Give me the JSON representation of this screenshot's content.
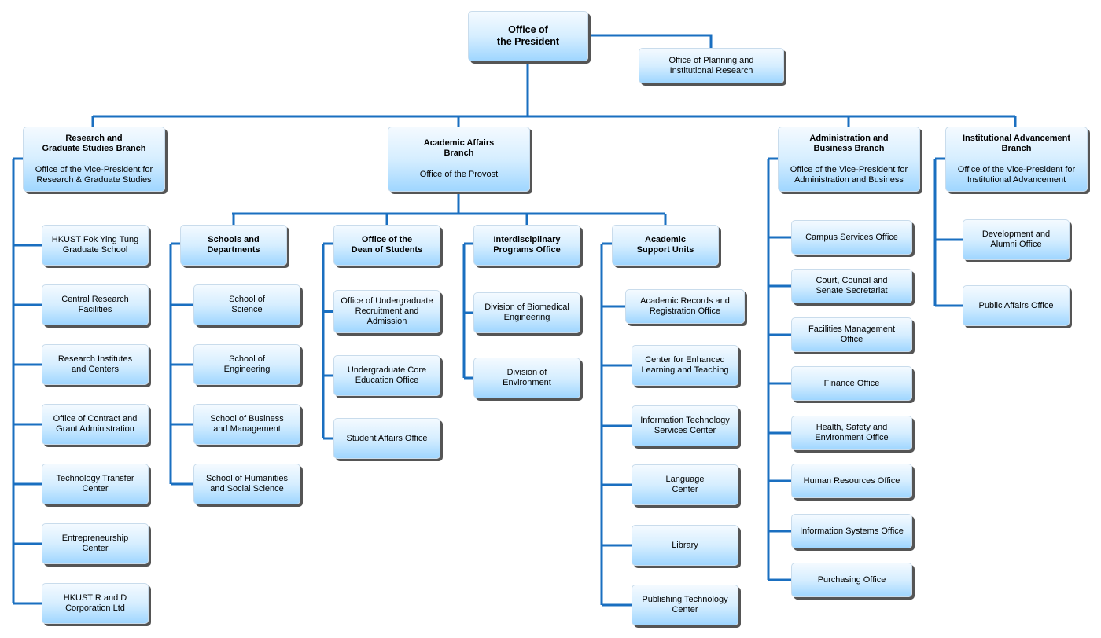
{
  "president": {
    "title": "Office of\nthe President"
  },
  "planning": {
    "title": "Office of Planning and\nInstitutional Research"
  },
  "branches": {
    "research": {
      "title": "Research and\nGraduate Studies Branch",
      "subtitle": "Office of the Vice-President for\nResearch & Graduate Studies",
      "children": [
        "HKUST Fok Ying Tung\nGraduate School",
        "Central Research\nFacilities",
        "Research Institutes\nand Centers",
        "Office of Contract and\nGrant Administration",
        "Technology Transfer\nCenter",
        "Entrepreneurship\nCenter",
        "HKUST R and D\nCorporation Ltd"
      ]
    },
    "academic": {
      "title": "Academic Affairs\nBranch",
      "subtitle": "Office of the Provost",
      "groups": {
        "schools": {
          "title": "Schools and\nDepartments",
          "children": [
            "School of\nScience",
            "School of\nEngineering",
            "School of Business\nand Management",
            "School of Humanities\nand Social Science"
          ]
        },
        "dean": {
          "title": "Office of the\nDean of Students",
          "children": [
            "Office of Undergraduate\nRecruitment and\nAdmission",
            "Undergraduate Core\nEducation Office",
            "Student Affairs Office"
          ]
        },
        "interdisciplinary": {
          "title": "Interdisciplinary\nPrograms Office",
          "children": [
            "Division of Biomedical\nEngineering",
            "Division of\nEnvironment"
          ]
        },
        "support": {
          "title": "Academic\nSupport Units",
          "children": [
            "Academic Records and\nRegistration Office",
            "Center for Enhanced\nLearning and Teaching",
            "Information Technology\nServices Center",
            "Language\nCenter",
            "Library",
            "Publishing Technology\nCenter"
          ]
        }
      }
    },
    "administration": {
      "title": "Administration and\nBusiness Branch",
      "subtitle": "Office of the Vice-President for\nAdministration and Business",
      "children": [
        "Campus Services Office",
        "Court, Council and\nSenate Secretariat",
        "Facilities Management\nOffice",
        "Finance Office",
        "Health, Safety and\nEnvironment Office",
        "Human Resources Office",
        "Information Systems Office",
        "Purchasing Office"
      ]
    },
    "advancement": {
      "title": "Institutional Advancement\nBranch",
      "subtitle": "Office of the Vice-President for\nInstitutional Advancement",
      "children": [
        "Development and\nAlumni Office",
        "Public Affairs Office"
      ]
    }
  },
  "colors": {
    "connector": "#1a6fc0",
    "box_bottom": "#9fd6ff",
    "box_top": "#f4faff",
    "shadow": "#555555"
  }
}
